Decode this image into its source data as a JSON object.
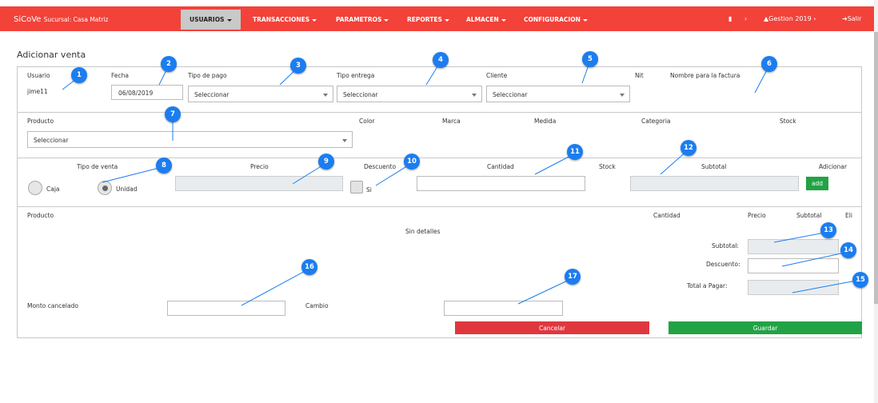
{
  "navbar": {
    "brand": "SiCoVe",
    "branch": "Sucursal: Casa Matriz",
    "menu": [
      "USUARIOS",
      "TRANSACCIONES",
      "PARAMETROS",
      "REPORTES",
      "ALMACEN",
      "CONFIGURACION"
    ],
    "gestion": "Gestion 2019",
    "salir": "Salir",
    "bg_color": "#f2423a"
  },
  "page": {
    "title": "Adicionar venta"
  },
  "header_row": {
    "labels": {
      "usuario": "Usuario",
      "fecha": "Fecha",
      "tipo_pago": "Tipo de pago",
      "tipo_entrega": "Tipo entrega",
      "cliente": "Cliente",
      "nit": "Nit",
      "nombre_factura": "Nombre para la factura"
    },
    "usuario_value": "jime11",
    "fecha_value": "06/08/2019",
    "tipo_pago_value": "Seleccionar",
    "tipo_entrega_value": "Seleccionar",
    "cliente_value": "Seleccionar"
  },
  "product_row": {
    "labels": {
      "producto": "Producto",
      "color": "Color",
      "marca": "Marca",
      "medida": "Medida",
      "categoria": "Categoria",
      "stock": "Stock"
    },
    "producto_value": "Seleccionar"
  },
  "sale_row": {
    "labels": {
      "tipo_venta": "Tipo de venta",
      "precio": "Precio",
      "descuento": "Descuento",
      "cantidad": "Cantidad",
      "stock": "Stock",
      "subtotal": "Subtotal",
      "adicionar": "Adicionar"
    },
    "radio_caja": "Caja",
    "radio_unidad": "Unidad",
    "selected_radio": "Unidad",
    "si_label": "Si",
    "add_button": "add"
  },
  "details": {
    "headers": {
      "producto": "Producto",
      "cantidad": "Cantidad",
      "precio": "Precio",
      "subtotal": "Subtotal",
      "eli": "Eli"
    },
    "empty": "Sin detalles",
    "subtotal_label": "Subtotal:",
    "descuento_label": "Descuento:",
    "total_label": "Total a Pagar:"
  },
  "payment": {
    "monto_label": "Monto cancelado",
    "cambio_label": "Cambio"
  },
  "actions": {
    "cancelar": "Cancelar",
    "guardar": "Guardar",
    "cancel_color": "#e0373f",
    "save_color": "#21a345"
  },
  "badges": [
    "1",
    "2",
    "3",
    "4",
    "5",
    "6",
    "7",
    "8",
    "9",
    "10",
    "11",
    "12",
    "13",
    "14",
    "15",
    "16",
    "17"
  ]
}
